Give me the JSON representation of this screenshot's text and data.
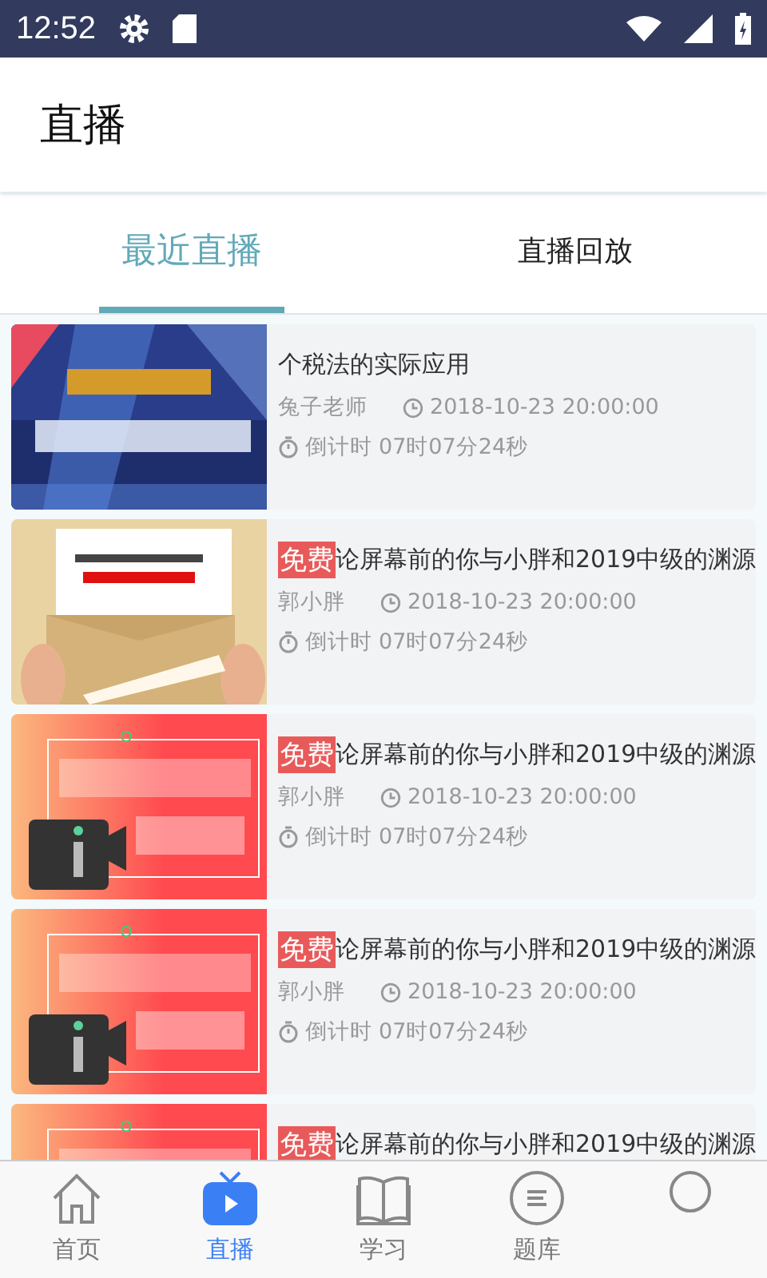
{
  "status_bar": {
    "time": "12:52"
  },
  "header": {
    "title": "直播"
  },
  "tabs": [
    {
      "label": "最近直播",
      "selected": true
    },
    {
      "label": "直播回放",
      "selected": false
    }
  ],
  "lives": [
    {
      "title": "个税法的实际应用",
      "teacher": "兔子老师",
      "time": "2018-10-23 20:00:00",
      "countdown_label": "倒计时",
      "countdown": "07时07分24秒"
    },
    {
      "badge": "免费",
      "title": "论屏幕前的你与小胖和2019中级的渊源",
      "teacher": "郭小胖",
      "time": "2018-10-23 20:00:00",
      "countdown_label": "倒计时",
      "countdown": "07时07分24秒"
    },
    {
      "badge": "免费",
      "title": "论屏幕前的你与小胖和2019中级的渊源",
      "teacher": "郭小胖",
      "time": "2018-10-23 20:00:00",
      "countdown_label": "倒计时",
      "countdown": "07时07分24秒"
    },
    {
      "badge": "免费",
      "title": "论屏幕前的你与小胖和2019中级的渊源",
      "teacher": "郭小胖",
      "time": "2018-10-23 20:00:00",
      "countdown_label": "倒计时",
      "countdown": "07时07分24秒"
    },
    {
      "badge": "免费",
      "title": "论屏幕前的你与小胖和2019中级的渊源"
    }
  ],
  "bottom_nav": [
    {
      "kind": "home",
      "label": "首页",
      "selected": false
    },
    {
      "kind": "live",
      "label": "直播",
      "selected": true
    },
    {
      "kind": "study",
      "label": "学习",
      "selected": false
    },
    {
      "kind": "bank",
      "label": "题库",
      "selected": false
    },
    {
      "kind": "me",
      "selected": false
    }
  ]
}
